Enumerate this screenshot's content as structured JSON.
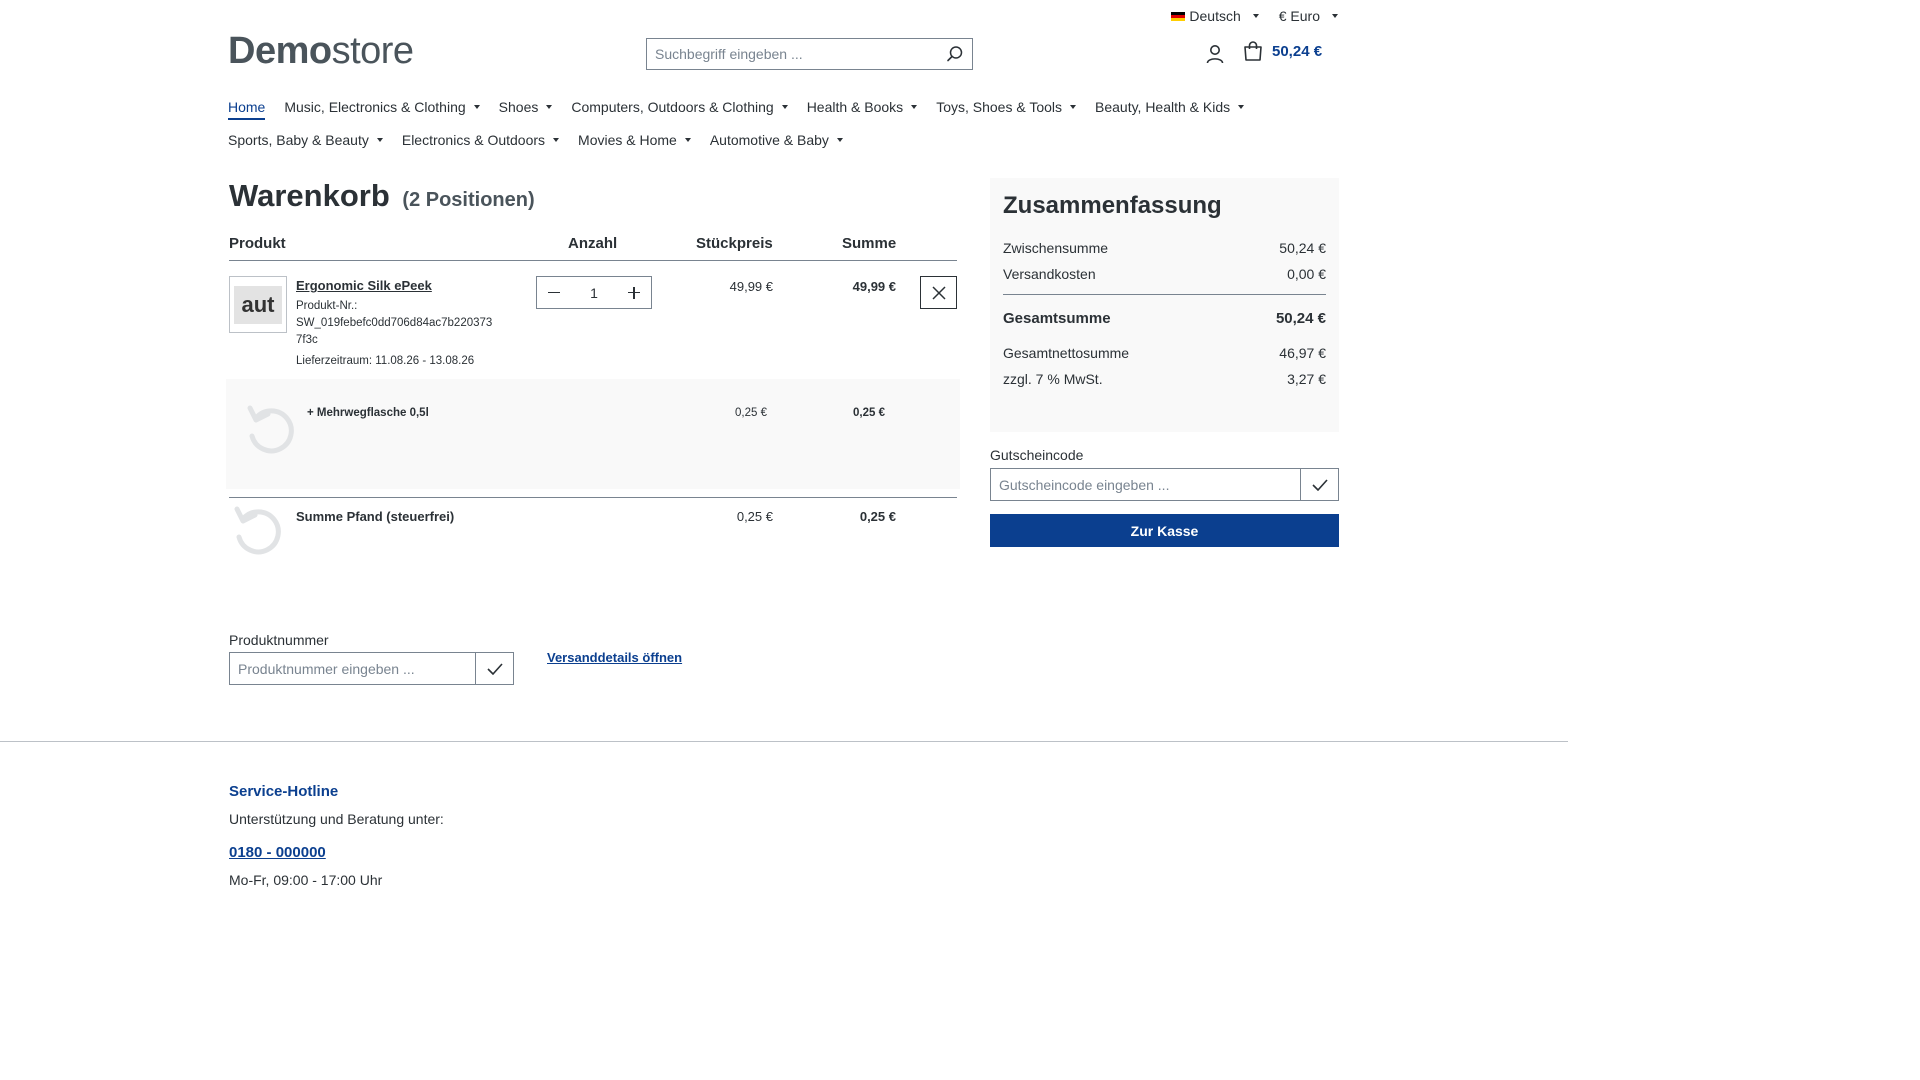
{
  "topbar": {
    "language": "Deutsch",
    "currency": "€ Euro"
  },
  "logo": {
    "bold": "Demo",
    "light": "store"
  },
  "search": {
    "placeholder": "Suchbegriff eingeben ..."
  },
  "header": {
    "cart_total": "50,24 €"
  },
  "nav": {
    "row1": [
      {
        "label": "Home",
        "active": true
      },
      {
        "label": "Music, Electronics & Clothing"
      },
      {
        "label": "Shoes"
      },
      {
        "label": "Computers, Outdoors & Clothing"
      },
      {
        "label": "Health & Books"
      },
      {
        "label": "Toys, Shoes & Tools"
      },
      {
        "label": "Beauty, Health & Kids"
      }
    ],
    "row2": [
      {
        "label": "Sports, Baby & Beauty"
      },
      {
        "label": "Electronics & Outdoors"
      },
      {
        "label": "Movies & Home"
      },
      {
        "label": "Automotive & Baby"
      }
    ]
  },
  "cart": {
    "title": "Warenkorb",
    "count": "(2 Positionen)",
    "headers": {
      "product": "Produkt",
      "quantity": "Anzahl",
      "unit_price": "Stückpreis",
      "total": "Summe"
    },
    "item": {
      "thumb_text": "aut",
      "name": "Ergonomic Silk ePeek",
      "number_label": "Produkt-Nr.:",
      "number": "SW_019febefc0dd706d84ac7b2203737f3c",
      "delivery": "Lieferzeitraum: 11.08.26 - 13.08.26",
      "quantity": "1",
      "unit_price": "49,99 €",
      "total": "49,99 €"
    },
    "deposit_item": {
      "name": "+ Mehrwegflasche 0,5l",
      "unit_price": "0,25 €",
      "total": "0,25 €"
    },
    "deposit_sum": {
      "name": "Summe Pfand (steuerfrei)",
      "unit_price": "0,25 €",
      "total": "0,25 €"
    }
  },
  "product_number": {
    "label": "Produktnummer",
    "placeholder": "Produktnummer eingeben ..."
  },
  "shipping_link": "Versanddetails öffnen",
  "summary": {
    "title": "Zusammenfassung",
    "subtotal_label": "Zwischensumme",
    "subtotal": "50,24 €",
    "shipping_label": "Versandkosten",
    "shipping": "0,00 €",
    "total_label": "Gesamtsumme",
    "total": "50,24 €",
    "net_label": "Gesamtnettosumme",
    "net": "46,97 €",
    "tax_label": "zzgl. 7 % MwSt.",
    "tax": "3,27 €"
  },
  "voucher": {
    "label": "Gutscheincode",
    "placeholder": "Gutscheincode eingeben ..."
  },
  "checkout_label": "Zur Kasse",
  "footer": {
    "title": "Service-Hotline",
    "subtitle": "Unterstützung und Beratung unter:",
    "phone": "0180 - 000000",
    "hours": "Mo-Fr, 09:00 - 17:00 Uhr"
  },
  "colors": {
    "brand": "#0b3f8f",
    "text": "#2b3136",
    "border": "#798490"
  }
}
